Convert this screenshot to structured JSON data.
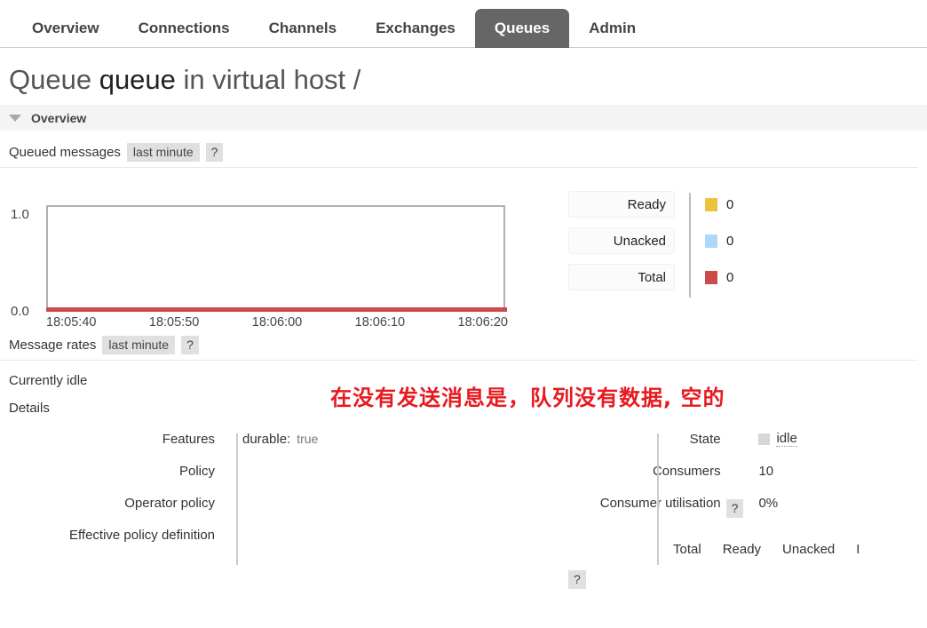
{
  "nav": {
    "tabs": [
      {
        "label": "Overview",
        "active": false
      },
      {
        "label": "Connections",
        "active": false
      },
      {
        "label": "Channels",
        "active": false
      },
      {
        "label": "Exchanges",
        "active": false
      },
      {
        "label": "Queues",
        "active": true
      },
      {
        "label": "Admin",
        "active": false
      }
    ]
  },
  "title": {
    "prefix": "Queue ",
    "queue_name": "queue",
    "suffix": " in virtual host /"
  },
  "overview_section": {
    "label": "Overview",
    "toggle_icon": "triangle-down-icon"
  },
  "queued_messages": {
    "label": "Queued messages",
    "period": "last minute",
    "help": "?"
  },
  "chart_data": {
    "type": "line",
    "title": "Queued messages",
    "xlabel": "",
    "ylabel": "",
    "ylim": [
      0.0,
      1.0
    ],
    "ytick_labels": [
      "1.0",
      "0.0"
    ],
    "xtick_labels": [
      "18:05:40",
      "18:05:50",
      "18:06:00",
      "18:06:10",
      "18:06:20"
    ],
    "grid": false,
    "legend_position": "right",
    "series": [
      {
        "name": "Ready",
        "color": "#edc240",
        "value": "0",
        "values": [
          0,
          0,
          0,
          0,
          0
        ]
      },
      {
        "name": "Unacked",
        "color": "#afd8f8",
        "value": "0",
        "values": [
          0,
          0,
          0,
          0,
          0
        ]
      },
      {
        "name": "Total",
        "color": "#cb4b4b",
        "value": "0",
        "values": [
          0,
          0,
          0,
          0,
          0
        ]
      }
    ]
  },
  "message_rates": {
    "label": "Message rates",
    "period": "last minute",
    "help": "?",
    "status": "Currently idle"
  },
  "annotation": {
    "text": "在没有发送消息是，队列没有数据, 空的",
    "color": "#e8191f"
  },
  "details": {
    "label": "Details",
    "left": [
      {
        "key": "Features",
        "value": "durable:",
        "value_muted": "true"
      },
      {
        "key": "Policy",
        "value": "",
        "value_muted": ""
      },
      {
        "key": "Operator policy",
        "value": "",
        "value_muted": ""
      },
      {
        "key": "Effective policy definition",
        "value": "",
        "value_muted": ""
      }
    ],
    "right": [
      {
        "key": "State",
        "help": "",
        "value": "idle",
        "swatch": true
      },
      {
        "key": "Consumers",
        "help": "",
        "value": "10",
        "swatch": false
      },
      {
        "key": "Consumer utilisation",
        "help": "?",
        "value": "0%",
        "swatch": false
      }
    ],
    "mini_table_headers": [
      "Total",
      "Ready",
      "Unacked",
      "I"
    ],
    "bottom_key_help": "?"
  }
}
